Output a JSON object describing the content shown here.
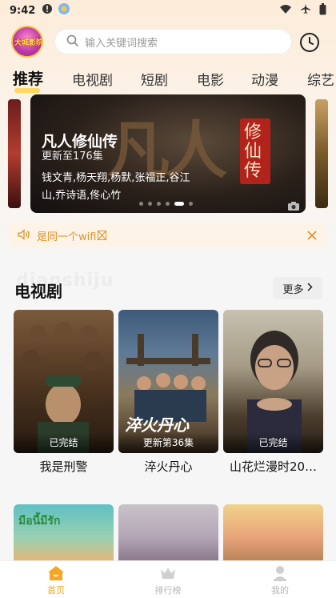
{
  "status_bar": {
    "time": "9:42"
  },
  "header": {
    "logo_text": "大城影院",
    "search": {
      "placeholder": "输入关键词搜索"
    }
  },
  "tabs": [
    {
      "label": "推荐",
      "active": true
    },
    {
      "label": "电视剧"
    },
    {
      "label": "短剧"
    },
    {
      "label": "电影"
    },
    {
      "label": "动漫"
    },
    {
      "label": "综艺"
    }
  ],
  "banner": {
    "title": "凡人修仙传",
    "subtitle": "更新至176集",
    "cast": "钱文青,杨天翔,杨默,张福正,谷江山,乔诗语,佟心竹",
    "artwork_big_text": "凡人",
    "artwork_seal_text": "修仙传",
    "page_count": 6,
    "active_page": 4
  },
  "notice": {
    "text": "是同一个wifi"
  },
  "section": {
    "title": "电视剧",
    "watermark": "dianshiju",
    "more_label": "更多"
  },
  "cards": [
    {
      "title": "我是刑警",
      "badge": "已完结"
    },
    {
      "title": "淬火丹心",
      "badge": "更新第36集",
      "poster_text": "淬火丹心"
    },
    {
      "title": "山花烂漫时20…",
      "badge": "已完结"
    }
  ],
  "row2_cards": [
    {
      "poster_text": "มือนี้มีรัก"
    },
    {
      "poster_text": ""
    },
    {
      "poster_text": ""
    }
  ],
  "bottom_nav": [
    {
      "label": "首页",
      "active": true
    },
    {
      "label": "排行榜"
    },
    {
      "label": "我的"
    }
  ],
  "colors": {
    "accent": "#f5a623",
    "notice_text": "#e2902a",
    "tab_underline": "#ffd24a"
  }
}
